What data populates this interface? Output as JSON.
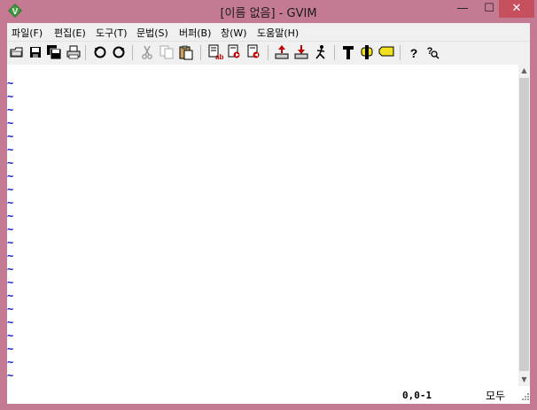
{
  "window": {
    "title": "[이름 없음] - GVIM",
    "minimize_glyph": "—",
    "maximize_glyph": "☐",
    "close_glyph": "✕"
  },
  "menu": {
    "items": [
      {
        "label": "파일(F)"
      },
      {
        "label": "편집(E)"
      },
      {
        "label": "도구(T)"
      },
      {
        "label": "문법(S)"
      },
      {
        "label": "버퍼(B)"
      },
      {
        "label": "창(W)"
      },
      {
        "label": "도움말(H)"
      }
    ]
  },
  "toolbar": {
    "buttons": [
      "open-icon",
      "save-icon",
      "save-all-icon",
      "print-icon",
      "undo-icon",
      "redo-icon",
      "cut-icon",
      "copy-icon",
      "paste-icon",
      "replace-icon",
      "find-next-icon",
      "find-prev-icon",
      "load-session-icon",
      "save-session-icon",
      "run-script-icon",
      "make-icon",
      "run-ctags-icon",
      "tag-jump-icon",
      "help-icon",
      "find-help-icon"
    ]
  },
  "editor": {
    "empty_line_marker": "~"
  },
  "status": {
    "ruler": "0,0-1",
    "position": "모두"
  },
  "colors": {
    "frame": "#c57a93",
    "tilde": "#1010d0",
    "close_button": "#c7505f"
  }
}
